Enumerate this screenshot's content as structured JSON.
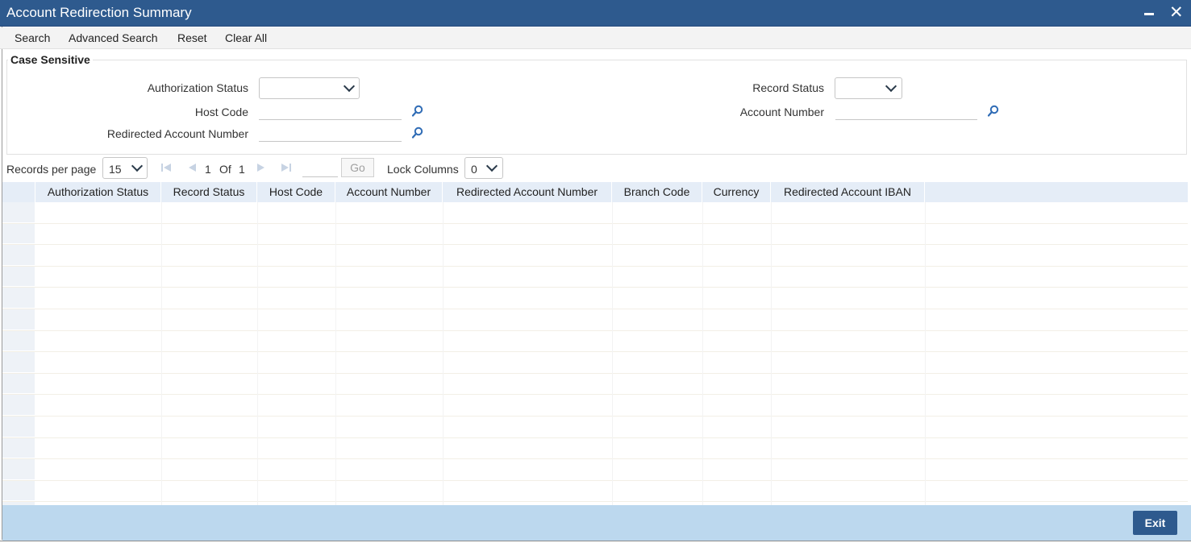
{
  "window": {
    "title": "Account Redirection Summary"
  },
  "toolbar": {
    "search": "Search",
    "advanced_search": "Advanced Search",
    "reset": "Reset",
    "clear_all": "Clear All"
  },
  "criteria": {
    "legend": "Case Sensitive",
    "authorization_status_label": "Authorization Status",
    "authorization_status_value": "",
    "record_status_label": "Record Status",
    "record_status_value": "",
    "host_code_label": "Host Code",
    "host_code_value": "",
    "account_number_label": "Account Number",
    "account_number_value": "",
    "redirected_account_number_label": "Redirected Account Number",
    "redirected_account_number_value": ""
  },
  "pager": {
    "records_per_page_label": "Records per page",
    "records_per_page_value": "15",
    "current_page": "1",
    "of_label": "Of",
    "total_pages": "1",
    "go_label": "Go",
    "lock_columns_label": "Lock Columns",
    "lock_columns_value": "0"
  },
  "grid": {
    "columns": [
      "Authorization Status",
      "Record Status",
      "Host Code",
      "Account Number",
      "Redirected Account Number",
      "Branch Code",
      "Currency",
      "Redirected Account IBAN"
    ],
    "rows": []
  },
  "footer": {
    "exit": "Exit"
  },
  "colors": {
    "title_bar": "#2e5a8e",
    "header_row": "#e5edf7",
    "footer": "#bcd8ee",
    "exit_button": "#2e5a8e"
  }
}
